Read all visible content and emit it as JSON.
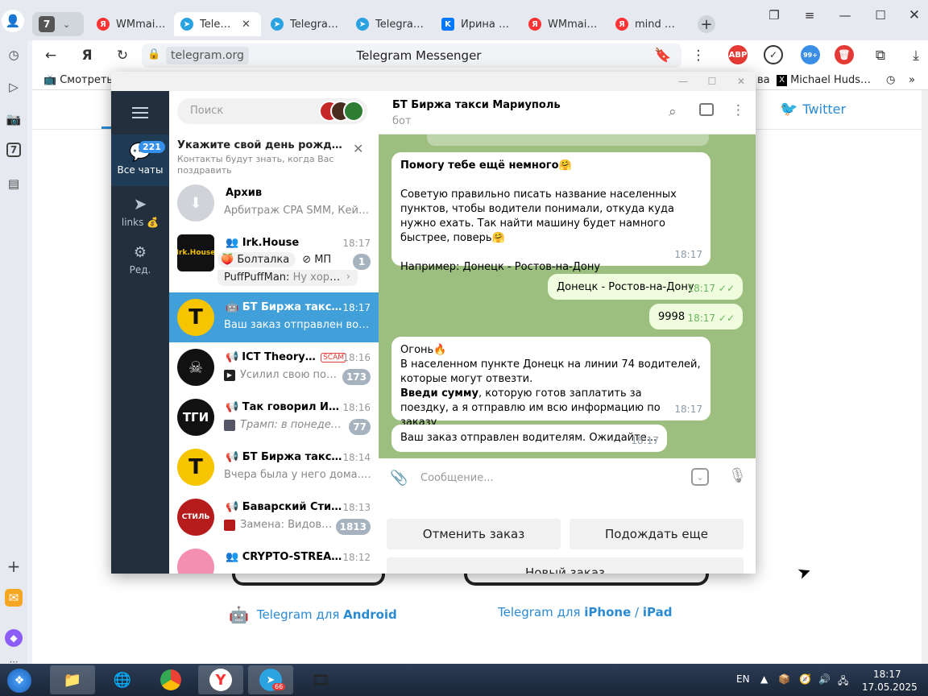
{
  "browser": {
    "tab_group_count": "7",
    "tabs": [
      {
        "label": "WMmail.ru",
        "icon": "ya"
      },
      {
        "label": "Telegram Web",
        "icon": "tg",
        "active": true
      },
      {
        "label": "Telegram Web",
        "icon": "tg"
      },
      {
        "label": "Telegram Web",
        "icon": "tg"
      },
      {
        "label": "Ирина Попова",
        "icon": "vk"
      },
      {
        "label": "WMmail.ru",
        "icon": "ya"
      },
      {
        "label": "mind money",
        "icon": "ya"
      }
    ],
    "address_domain": "telegram.org",
    "page_title": "Telegram Messenger",
    "ext_abp": "ABP",
    "ext_badge": "99+",
    "bookmarks": [
      {
        "label": "Смотреть"
      },
      {
        "label": "ва"
      },
      {
        "label": "Michael Hudson ("
      }
    ],
    "sidebar_badge": "7"
  },
  "page": {
    "twitter_label": "Twitter",
    "android_prefix": "Telegram для",
    "android_label": "Android",
    "ios_prefix": "Telegram для",
    "ios_label1": "iPhone",
    "ios_sep": "/",
    "ios_label2": "iPad"
  },
  "tg": {
    "rail": {
      "all_chats_label": "Все чаты",
      "all_chats_badge": "221",
      "links_label": "links 💰",
      "edit_label": "Ред."
    },
    "search_placeholder": "Поиск",
    "birthday": {
      "title": "Укажите свой день рождения! 🎂",
      "text": "Контакты будут знать, когда Вас поздравить"
    },
    "archive": {
      "name": "Архив",
      "preview": "Арбитраж CPA SMM, Кейсы ..."
    },
    "chats": [
      {
        "name": "Irk.House",
        "time": "18:17",
        "topic1": "Болталка",
        "topic2": "МП",
        "preview_sender": "PuffPuffMan:",
        "preview": "Ну хоро...",
        "badge": "1",
        "type": "group"
      },
      {
        "name": "БТ Биржа такси ...",
        "time": "18:17",
        "preview": "Ваш заказ отправлен водит...",
        "type": "bot",
        "selected": true
      },
      {
        "name": "ICT Theory [T...",
        "scam": "SCAM",
        "time": "18:16",
        "preview": "Усилил свою пози...",
        "badge": "173",
        "type": "channel"
      },
      {
        "name": "Так говорил Инве...",
        "time": "18:16",
        "preview": "Трамп: в понедельн...",
        "badge": "77",
        "type": "channel"
      },
      {
        "name": "БТ Биржа такси А...",
        "time": "18:14",
        "preview": "Вчера была у него дома. На...",
        "type": "channel"
      },
      {
        "name": "Баварский Стиль...",
        "time": "18:13",
        "preview": "Замена:  Видови...",
        "badge": "1813",
        "type": "channel"
      },
      {
        "name": "CRYPTO-STREAMI...",
        "time": "18:12",
        "preview": "",
        "type": "group"
      }
    ],
    "header": {
      "title": "БТ Биржа такси Мариуполь",
      "subtitle": "бот"
    },
    "messages": {
      "m1_title": "Помогу тебе ещё немного🤗",
      "m1_p1": "Советую правильно писать название населенных пунктов, чтобы водители понимали, откуда куда нужно ехать. Так найти машину будет намного быстрее, поверь🤗",
      "m1_p2": "Например: Донецк - Ростов-на-Дону",
      "m1_time": "18:17",
      "m2_text": "Донецк - Ростов-на-Дону",
      "m2_time": "18:17",
      "m3_text": "9998",
      "m3_time": "18:17",
      "m4_l1": "Огонь🔥",
      "m4_l2": "В населенном пункте Донецк на линии 74  водителей, которые могут отвезти.",
      "m4_bold": "Введи сумму",
      "m4_rest": ", которую готов заплатить за поездку, а я отправлю им всю информацию по заказу",
      "m4_time": "18:17",
      "m5_text": "Ваш заказ отправлен водителям. Ожидайте...",
      "m5_time": "18:17"
    },
    "composer_placeholder": "Сообщение...",
    "keyboard": {
      "cancel": "Отменить заказ",
      "wait": "Подождать еще",
      "new": "Новый заказ"
    }
  },
  "taskbar": {
    "lang": "EN",
    "telegram_badge": "66",
    "time": "18:17",
    "date": "17.05.2025"
  },
  "colors": {
    "telegram_blue": "#419fd9",
    "rail": "#242f3d",
    "chat_bg": "#9cbe7e",
    "out_bubble": "#effdde"
  }
}
